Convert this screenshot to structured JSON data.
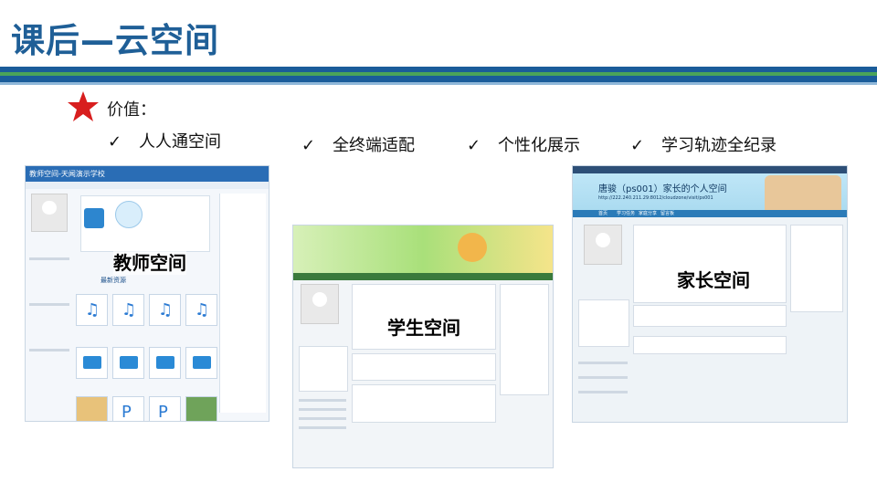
{
  "header": {
    "title": "课后—云空间"
  },
  "bullets": {
    "value_label": "价值：",
    "items": [
      "人人通空间",
      "全终端适配",
      "个性化展示",
      "学习轨迹全纪录"
    ],
    "check_glyph": "✓"
  },
  "screenshots": {
    "teacher": {
      "caption": "教师空间",
      "brand": "教师空间-天闻演示学校",
      "section_resources": "最新资源"
    },
    "student": {
      "caption": "学生空间"
    },
    "parent": {
      "caption": "家长空间",
      "banner_title": "唐骏（ps001）家长的个人空间",
      "url": "http://222.240.211.29:8012/cloudzone/visit/ps001",
      "nav": [
        "首页",
        "学习任务",
        "家庭分享",
        "留言板"
      ]
    }
  },
  "colors": {
    "title": "#1f5f97",
    "band_blue": "#1a5c9a",
    "band_green": "#4aa35a",
    "star": "#d81e1e"
  }
}
